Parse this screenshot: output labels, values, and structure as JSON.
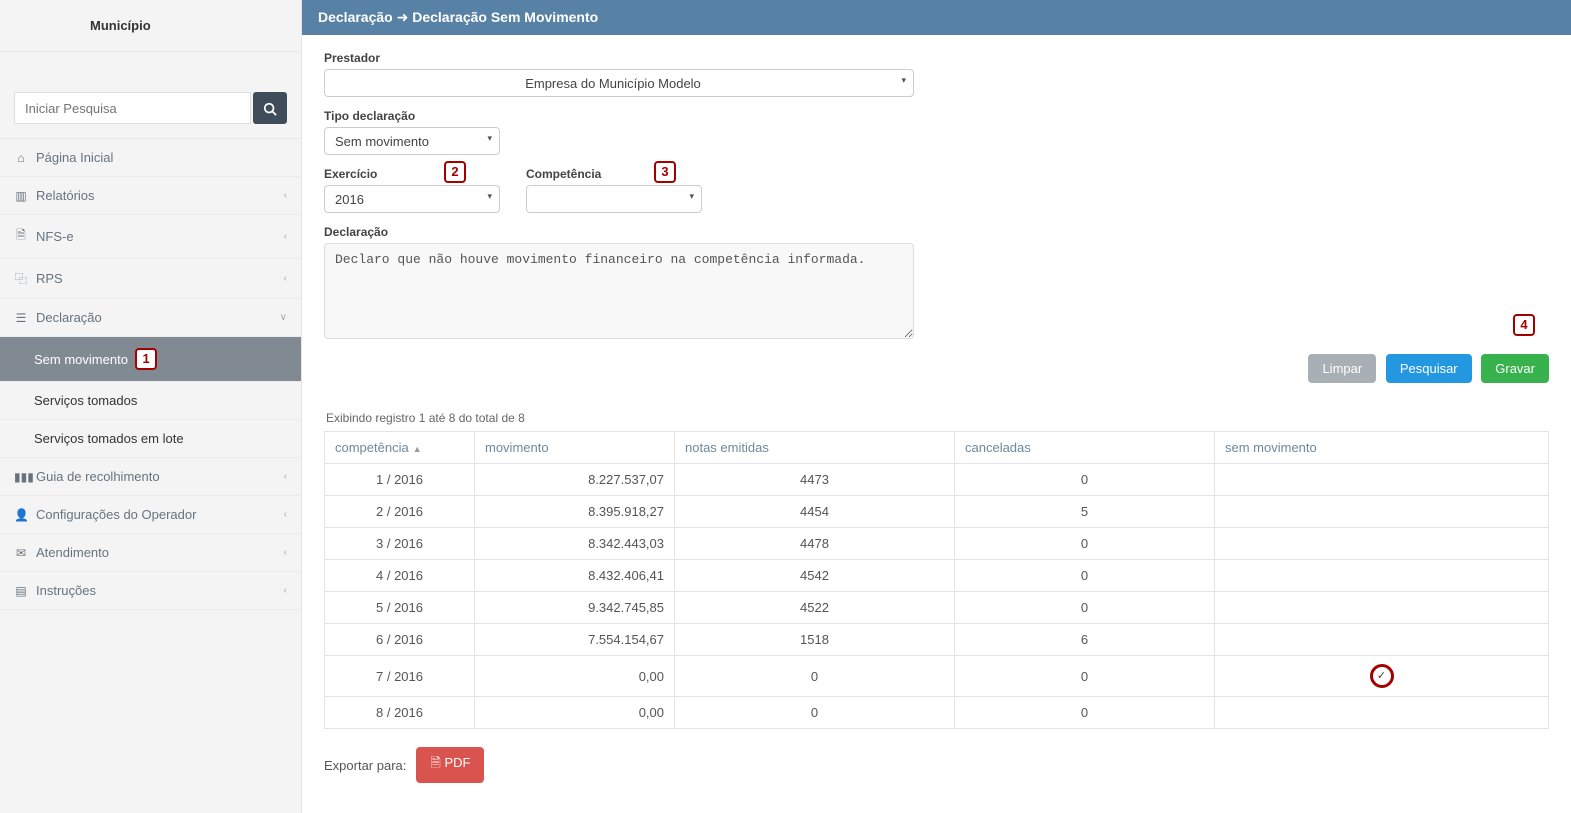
{
  "sidebar": {
    "title": "Município",
    "search_placeholder": "Iniciar Pesquisa",
    "items": [
      {
        "icon": "home-icon",
        "label": "Página Inicial",
        "expandable": false
      },
      {
        "icon": "bars-icon",
        "label": "Relatórios",
        "expandable": true
      },
      {
        "icon": "file-icon",
        "label": "NFS-e",
        "expandable": true
      },
      {
        "icon": "copy-icon",
        "label": "RPS",
        "expandable": true
      },
      {
        "icon": "clipboard-icon",
        "label": "Declaração",
        "expandable": true,
        "open": true,
        "children": [
          {
            "label": "Sem movimento",
            "active": true,
            "marker": "1"
          },
          {
            "label": "Serviços tomados"
          },
          {
            "label": "Serviços tomados em lote"
          }
        ]
      },
      {
        "icon": "barcode-icon",
        "label": "Guia de recolhimento",
        "expandable": true
      },
      {
        "icon": "user-icon",
        "label": "Configurações do Operador",
        "expandable": true
      },
      {
        "icon": "mail-icon",
        "label": "Atendimento",
        "expandable": true
      },
      {
        "icon": "book-icon",
        "label": "Instruções",
        "expandable": true
      }
    ]
  },
  "header": {
    "crumb1": "Declaração",
    "crumb2": "Declaração Sem Movimento"
  },
  "form": {
    "prestador_label": "Prestador",
    "prestador_value": "Empresa do Município Modelo",
    "tipo_label": "Tipo declaração",
    "tipo_value": "Sem movimento",
    "exercicio_label": "Exercício",
    "exercicio_value": "2016",
    "exercicio_marker": "2",
    "competencia_label": "Competência",
    "competencia_value": "",
    "competencia_marker": "3",
    "declaracao_label": "Declaração",
    "declaracao_text": "Declaro que não houve movimento financeiro na competência informada.",
    "btn_limpar": "Limpar",
    "btn_pesquisar": "Pesquisar",
    "btn_gravar": "Gravar",
    "btn_gravar_marker": "4"
  },
  "results": {
    "info": "Exibindo registro 1 até 8 do total de 8",
    "cols": {
      "competencia": "competência",
      "movimento": "movimento",
      "notas": "notas emitidas",
      "canceladas": "canceladas",
      "sem_mov": "sem movimento"
    },
    "rows": [
      {
        "comp": "1 / 2016",
        "mov": "8.227.537,07",
        "notas": "4473",
        "canc": "0",
        "sem": ""
      },
      {
        "comp": "2 / 2016",
        "mov": "8.395.918,27",
        "notas": "4454",
        "canc": "5",
        "sem": ""
      },
      {
        "comp": "3 / 2016",
        "mov": "8.342.443,03",
        "notas": "4478",
        "canc": "0",
        "sem": ""
      },
      {
        "comp": "4 / 2016",
        "mov": "8.432.406,41",
        "notas": "4542",
        "canc": "0",
        "sem": ""
      },
      {
        "comp": "5 / 2016",
        "mov": "9.342.745,85",
        "notas": "4522",
        "canc": "0",
        "sem": ""
      },
      {
        "comp": "6 / 2016",
        "mov": "7.554.154,67",
        "notas": "1518",
        "canc": "6",
        "sem": ""
      },
      {
        "comp": "7 / 2016",
        "mov": "0,00",
        "notas": "0",
        "canc": "0",
        "sem": "check"
      },
      {
        "comp": "8 / 2016",
        "mov": "0,00",
        "notas": "0",
        "canc": "0",
        "sem": ""
      }
    ],
    "export_label": "Exportar para:",
    "export_pdf": "PDF"
  }
}
